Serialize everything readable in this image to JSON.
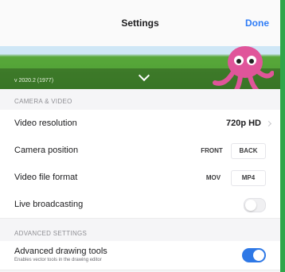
{
  "navbar": {
    "title": "Settings",
    "done_label": "Done"
  },
  "banner": {
    "version": "v 2020.2 (1977)"
  },
  "camera_video": {
    "header": "CAMERA & VIDEO",
    "video_resolution": {
      "label": "Video resolution",
      "value": "720p HD"
    },
    "camera_position": {
      "label": "Camera position",
      "options": [
        "FRONT",
        "BACK"
      ]
    },
    "video_file_format": {
      "label": "Video file format",
      "options": [
        "MOV",
        "MP4"
      ]
    },
    "live_broadcasting": {
      "label": "Live broadcasting",
      "enabled": false
    }
  },
  "advanced": {
    "header": "ADVANCED SETTINGS",
    "drawing_tools": {
      "label": "Advanced drawing tools",
      "sublabel": "Enables vector tools in the drawing editor",
      "enabled": true
    }
  },
  "colors": {
    "accent": "#2e78e6",
    "background_green": "#2fa64a"
  }
}
